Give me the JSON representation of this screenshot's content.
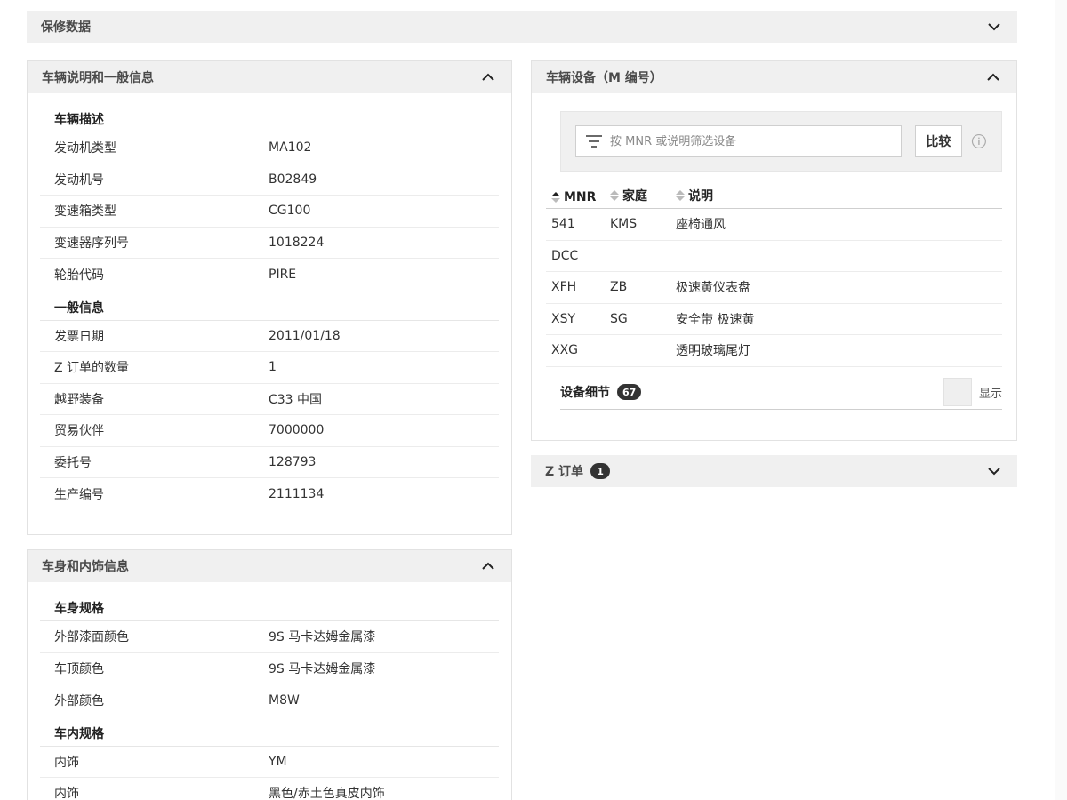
{
  "warranty": {
    "title": "保修数据"
  },
  "vehicle_desc": {
    "title": "车辆说明和一般信息",
    "sections": [
      {
        "label": "车辆描述",
        "rows": [
          {
            "k": "发动机类型",
            "v": "MA102"
          },
          {
            "k": "发动机号",
            "v": "B02849"
          },
          {
            "k": "变速箱类型",
            "v": "CG100"
          },
          {
            "k": "变速器序列号",
            "v": "1018224"
          },
          {
            "k": "轮胎代码",
            "v": "PIRE"
          }
        ]
      },
      {
        "label": "一般信息",
        "rows": [
          {
            "k": "发票日期",
            "v": "2011/01/18"
          },
          {
            "k": "Z 订单的数量",
            "v": "1"
          },
          {
            "k": "越野装备",
            "v": "C33 中国"
          },
          {
            "k": "贸易伙伴",
            "v": "7000000"
          },
          {
            "k": "委托号",
            "v": "128793"
          },
          {
            "k": "生产编号",
            "v": "2111134"
          }
        ]
      }
    ]
  },
  "body_interior": {
    "title": "车身和内饰信息",
    "sections": [
      {
        "label": "车身规格",
        "rows": [
          {
            "k": "外部漆面颜色",
            "v": "9S 马卡达姆金属漆"
          },
          {
            "k": "车顶颜色",
            "v": "9S 马卡达姆金属漆"
          },
          {
            "k": "外部颜色",
            "v": "M8W"
          }
        ]
      },
      {
        "label": "车内规格",
        "rows": [
          {
            "k": "内饰",
            "v": "YM"
          },
          {
            "k": "内饰",
            "v": "黑色/赤土色真皮内饰"
          }
        ]
      }
    ]
  },
  "equipment": {
    "title": "车辆设备（M 编号）",
    "filter_placeholder": "按 MNR 或说明筛选设备",
    "compare_label": "比较",
    "columns": {
      "mnr": "MNR",
      "family": "家庭",
      "desc": "说明"
    },
    "rows": [
      {
        "mnr": "541",
        "family": "KMS",
        "desc": "座椅通风"
      },
      {
        "mnr": "DCC",
        "family": "",
        "desc": ""
      },
      {
        "mnr": "XFH",
        "family": "ZB",
        "desc": "极速黄仪表盘"
      },
      {
        "mnr": "XSY",
        "family": "SG",
        "desc": "安全带 极速黄"
      },
      {
        "mnr": "XXG",
        "family": "",
        "desc": "透明玻璃尾灯"
      }
    ],
    "details_label": "设备细节",
    "details_count": "67",
    "show_label": "显示"
  },
  "z_orders": {
    "title": "Z 订单",
    "count": "1"
  },
  "colors": {
    "header_bg": "#f0f0f0",
    "badge_bg": "#333333",
    "border": "#e2e2e2"
  }
}
